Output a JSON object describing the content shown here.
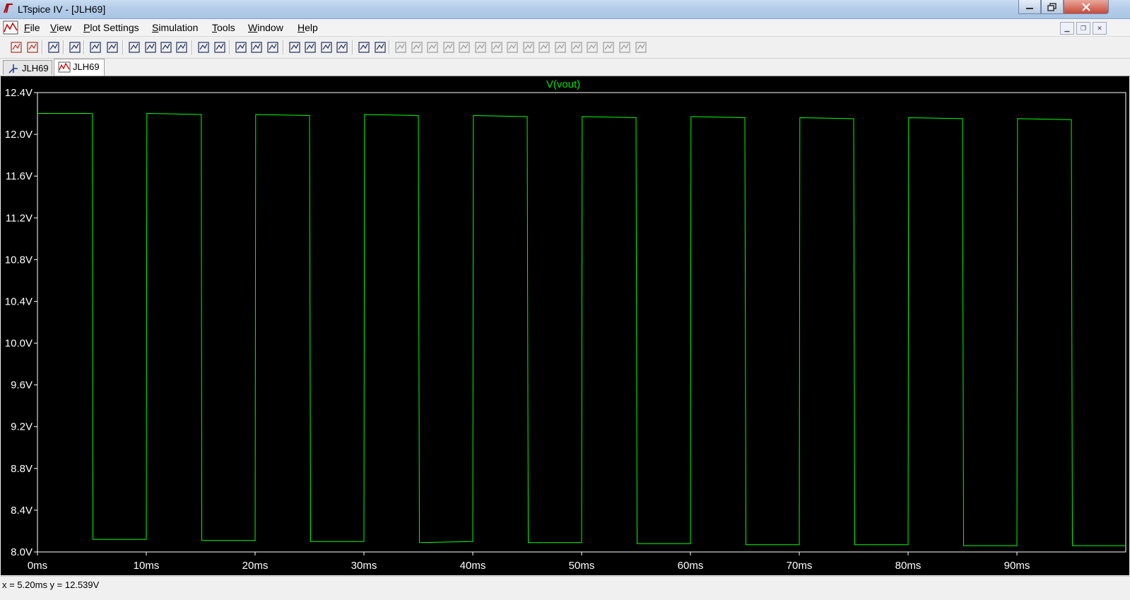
{
  "window": {
    "title": "LTspice IV - [JLH69]"
  },
  "menu": [
    {
      "label": "File",
      "accel": "F"
    },
    {
      "label": "View",
      "accel": "V"
    },
    {
      "label": "Plot Settings",
      "accel": "P"
    },
    {
      "label": "Simulation",
      "accel": "S"
    },
    {
      "label": "Tools",
      "accel": "T"
    },
    {
      "label": "Window",
      "accel": "W"
    },
    {
      "label": "Help",
      "accel": "H"
    }
  ],
  "toolbar": {
    "icons": [
      "new-schematic-icon",
      "open-icon",
      "save-icon",
      "control-panel-icon",
      "run-icon",
      "halt-icon",
      "zoom-in-icon",
      "zoom-out-icon",
      "zoom-full-icon",
      "zoom-cancel-icon",
      "autorange-icon",
      "pick-visible-traces-icon",
      "tile-horizontal-icon",
      "cascade-icon",
      "close-all-icon",
      "cut-icon",
      "copy-icon",
      "paste-icon",
      "find-icon",
      "print-preview-icon",
      "print-icon",
      "wire-icon",
      "ground-icon",
      "label-net-icon",
      "resistor-icon",
      "capacitor-icon",
      "inductor-icon",
      "diode-icon",
      "component-icon",
      "move-icon",
      "drag-icon",
      "undo-icon",
      "redo-icon",
      "rotate-icon",
      "mirror-icon",
      "text-icon",
      "spice-directive-icon"
    ]
  },
  "tabs": [
    {
      "label": "JLH69",
      "kind": "schematic",
      "active": false
    },
    {
      "label": "JLH69",
      "kind": "waveform",
      "active": true
    }
  ],
  "colors": {
    "plot_background": "#000000",
    "trace": "#00ff00",
    "axis_text": "#ffffff",
    "trace_label": "#00e000"
  },
  "chart_data": {
    "type": "line",
    "title": "V(vout)",
    "xlabel": "",
    "ylabel": "",
    "xlim": [
      0,
      100
    ],
    "ylim": [
      8.0,
      12.4
    ],
    "grid": false,
    "x_ticks": [
      "0ms",
      "10ms",
      "20ms",
      "30ms",
      "40ms",
      "50ms",
      "60ms",
      "70ms",
      "80ms",
      "90ms"
    ],
    "y_ticks": [
      "12.4V",
      "12.0V",
      "11.6V",
      "11.2V",
      "10.8V",
      "10.4V",
      "10.0V",
      "9.6V",
      "9.2V",
      "8.8V",
      "8.4V",
      "8.0V"
    ],
    "series": [
      {
        "name": "V(vout)",
        "x_unit": "ms",
        "y_unit": "V",
        "points": [
          [
            0,
            12.2
          ],
          [
            5.0,
            12.2
          ],
          [
            5.05,
            12.19
          ],
          [
            5.1,
            8.12
          ],
          [
            10.0,
            8.12
          ],
          [
            10.05,
            12.2
          ],
          [
            15.0,
            12.19
          ],
          [
            15.05,
            12.19
          ],
          [
            15.1,
            8.11
          ],
          [
            20.0,
            8.11
          ],
          [
            20.05,
            12.19
          ],
          [
            25.0,
            12.18
          ],
          [
            25.1,
            8.1
          ],
          [
            30.0,
            8.1
          ],
          [
            30.05,
            12.19
          ],
          [
            35.0,
            12.18
          ],
          [
            35.1,
            8.09
          ],
          [
            40.0,
            8.1
          ],
          [
            40.05,
            12.18
          ],
          [
            45.0,
            12.17
          ],
          [
            45.1,
            8.09
          ],
          [
            50.0,
            8.09
          ],
          [
            50.05,
            12.17
          ],
          [
            55.0,
            12.16
          ],
          [
            55.1,
            8.08
          ],
          [
            60.0,
            8.08
          ],
          [
            60.05,
            12.17
          ],
          [
            65.0,
            12.16
          ],
          [
            65.1,
            8.07
          ],
          [
            70.0,
            8.07
          ],
          [
            70.05,
            12.16
          ],
          [
            75.0,
            12.15
          ],
          [
            75.1,
            8.07
          ],
          [
            80.0,
            8.07
          ],
          [
            80.05,
            12.16
          ],
          [
            85.0,
            12.15
          ],
          [
            85.1,
            8.06
          ],
          [
            90.0,
            8.06
          ],
          [
            90.05,
            12.15
          ],
          [
            95.0,
            12.14
          ],
          [
            95.1,
            8.06
          ],
          [
            100.0,
            8.06
          ]
        ]
      }
    ]
  },
  "status": {
    "text": "x = 5.20ms    y = 12.539V"
  }
}
